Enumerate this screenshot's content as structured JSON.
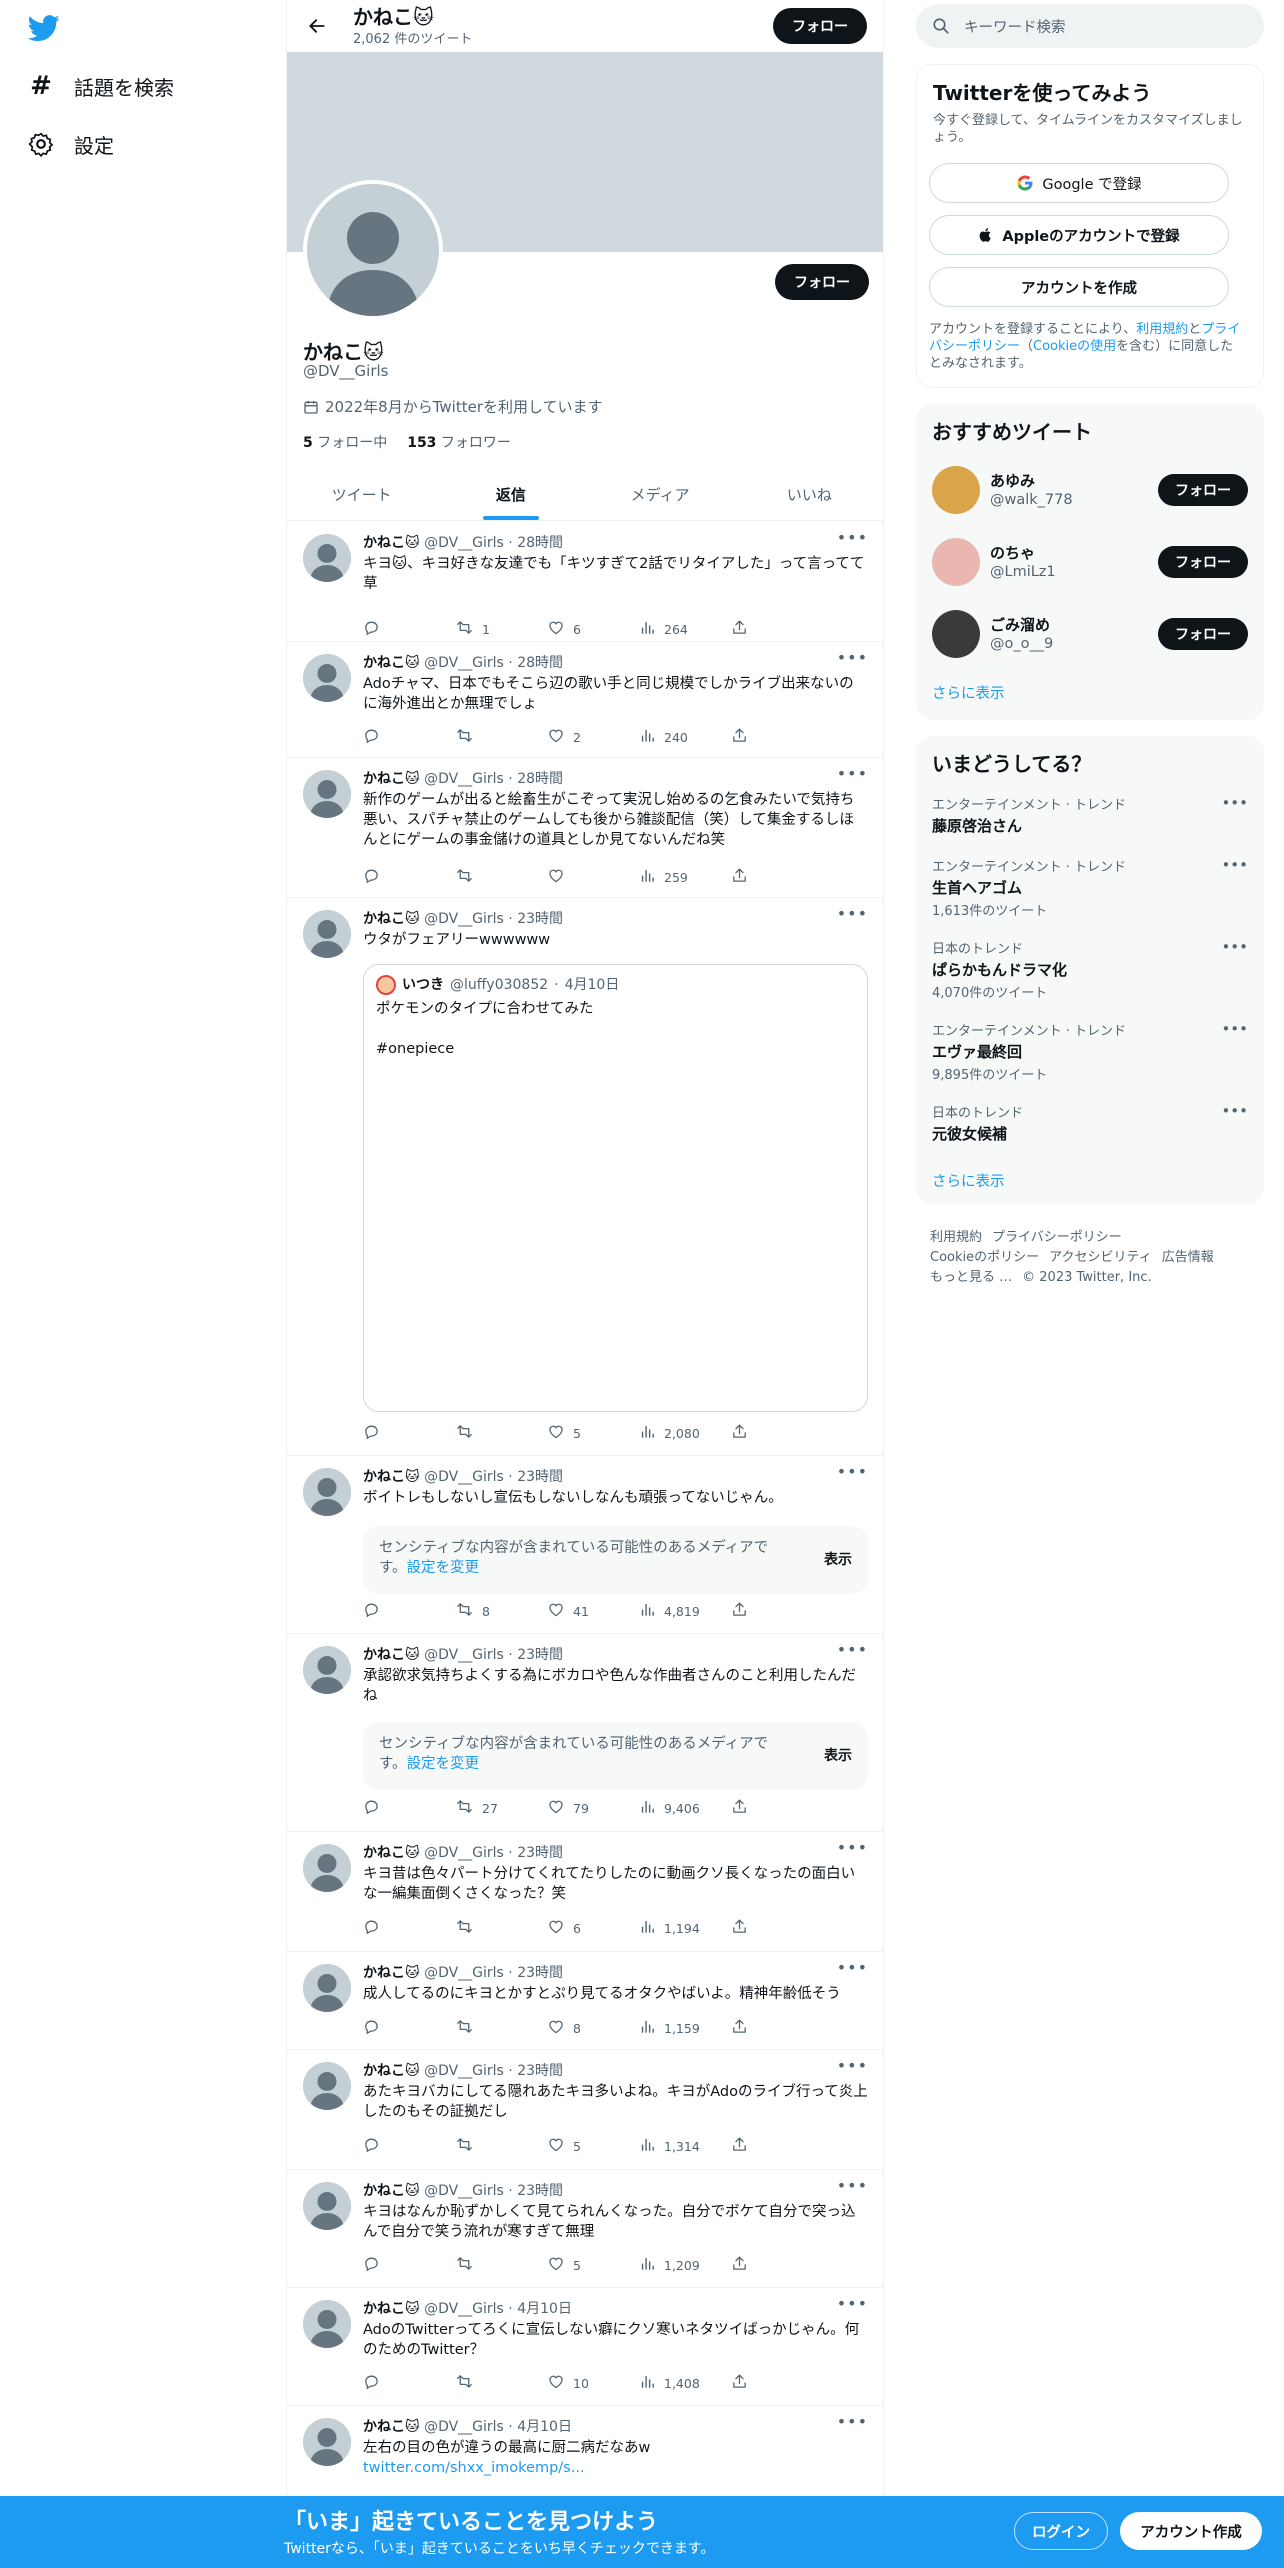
{
  "nav": {
    "explore": "話題を検索",
    "settings": "設定"
  },
  "header": {
    "name": "かねこ🐱",
    "tweet_count": "2,062 件のツイート",
    "follow": "フォロー"
  },
  "profile": {
    "name": "かねこ🐱",
    "handle": "@DV__Girls",
    "joined": "2022年8月からTwitterを利用しています",
    "following_count": "5",
    "following_label": "フォロー中",
    "followers_count": "153",
    "followers_label": "フォロワー",
    "follow": "フォロー"
  },
  "tabs": [
    "ツイート",
    "返信",
    "メディア",
    "いいね"
  ],
  "tweet_author": {
    "name": "かねこ🐱",
    "handle": "@DV__Girls"
  },
  "tweets": [
    {
      "time": "28時間",
      "text": "キヨ🐱、キヨ好きな友達でも「キツすぎて2話でリタイアした」って言ってて草",
      "retweets": "1",
      "likes": "6",
      "views": "264"
    },
    {
      "time": "28時間",
      "text": "Adoチャマ、日本でもそこら辺の歌い手と同じ規模でしかライブ出来ないのに海外進出とか無理でしょ",
      "retweets": "",
      "likes": "2",
      "views": "240"
    },
    {
      "time": "28時間",
      "text": "新作のゲームが出ると絵畜生がこぞって実況し始めるの乞食みたいで気持ち悪い、スパチャ禁止のゲームしても後から雑談配信（笑）して集金するしほんとにゲームの事金儲けの道具としか見てないんだね笑",
      "retweets": "",
      "likes": "",
      "views": "259"
    },
    {
      "time": "23時間",
      "text": "ウタがフェアリーwwwwww",
      "retweets": "",
      "likes": "5",
      "views": "2,080"
    },
    {
      "time": "23時間",
      "text": "ボイトレもしないし宣伝もしないしなんも頑張ってないじゃん。",
      "retweets": "8",
      "likes": "41",
      "views": "4,819"
    },
    {
      "time": "23時間",
      "text": "承認欲求気持ちよくする為にボカロや色んな作曲者さんのこと利用したんだね",
      "retweets": "27",
      "likes": "79",
      "views": "9,406"
    },
    {
      "time": "23時間",
      "text": "キヨ昔は色々パート分けてくれてたりしたのに動画クソ長くなったの面白いな一編集面倒くさくなった？笑",
      "retweets": "",
      "likes": "6",
      "views": "1,194"
    },
    {
      "time": "23時間",
      "text": "成人してるのにキヨとかすとぷり見てるオタクやばいよ。精神年齢低そう",
      "retweets": "",
      "likes": "8",
      "views": "1,159"
    },
    {
      "time": "23時間",
      "text": "あたキヨバカにしてる隠れあたキヨ多いよね。キヨがAdoのライブ行って炎上したのもその証拠だし",
      "retweets": "",
      "likes": "5",
      "views": "1,314"
    },
    {
      "time": "23時間",
      "text": "キヨはなんか恥ずかしくて見てられんくなった。自分でボケて自分で突っ込んで自分で笑う流れが寒すぎて無理",
      "retweets": "",
      "likes": "5",
      "views": "1,209"
    },
    {
      "time": "4月10日",
      "text": "AdoのTwitterってろくに宣伝しない癖にクソ寒いネタツイばっかじゃん。何のためのTwitter？",
      "retweets": "",
      "likes": "10",
      "views": "1,408"
    },
    {
      "time": "4月10日",
      "text": "左右の目の色が違うの最高に厨二病だなあw",
      "link": "twitter.com/shxx_imokemp/s..."
    }
  ],
  "quote": {
    "name": "いつき",
    "handle": "@luffy030852",
    "date": "4月10日",
    "line1": "ポケモンのタイプに合わせてみた",
    "line2": "#onepiece"
  },
  "sensitive": {
    "text": "センシティブな内容が含まれている可能性のあるメディアです。",
    "link": "設定を変更",
    "button": "表示"
  },
  "search": {
    "placeholder": "キーワード検索"
  },
  "signup": {
    "title": "Twitterを使ってみよう",
    "subtitle": "今すぐ登録して、タイムラインをカスタマイズしましょう。",
    "google": "Google で登録",
    "apple": "Appleのアカウントで登録",
    "create": "アカウントを作成",
    "terms_pre": "アカウントを登録することにより、",
    "terms_link": "利用規約",
    "terms_mid": "と",
    "privacy_link": "プライバシーポリシー",
    "cookie_pre": "（",
    "cookie_link": "Cookieの使用",
    "cookie_post": "を含む）に同意したとみなされます。"
  },
  "recommended": {
    "title": "おすすめツイート",
    "more": "さらに表示",
    "follow": "フォロー",
    "users": [
      {
        "name": "あゆみ",
        "handle": "@walk_778"
      },
      {
        "name": "のちゃ",
        "handle": "@LmiLz1"
      },
      {
        "name": "ごみ溜め",
        "handle": "@o_o__9"
      }
    ]
  },
  "trends": {
    "title": "いまどうしてる？",
    "more": "さらに表示",
    "items": [
      {
        "meta": "エンターテインメント · トレンド",
        "name": "藤原啓治さん",
        "count": ""
      },
      {
        "meta": "エンターテインメント · トレンド",
        "name": "生首ヘアゴム",
        "count": "1,613件のツイート"
      },
      {
        "meta": "日本のトレンド",
        "name": "ぱらかもんドラマ化",
        "count": "4,070件のツイート"
      },
      {
        "meta": "エンターテインメント · トレンド",
        "name": "エヴァ最終回",
        "count": "9,895件のツイート"
      },
      {
        "meta": "日本のトレンド",
        "name": "元彼女候補",
        "count": ""
      }
    ]
  },
  "footer": {
    "links": [
      "利用規約",
      "プライバシーポリシー",
      "Cookieのポリシー",
      "アクセシビリティ",
      "広告情報",
      "もっと見る …",
      "© 2023 Twitter, Inc."
    ]
  },
  "bottom": {
    "title": "「いま」起きていることを見つけよう",
    "subtitle": "Twitterなら、「いま」起きていることをいち早くチェックできます。",
    "login": "ログイン",
    "signup": "アカウント作成"
  }
}
